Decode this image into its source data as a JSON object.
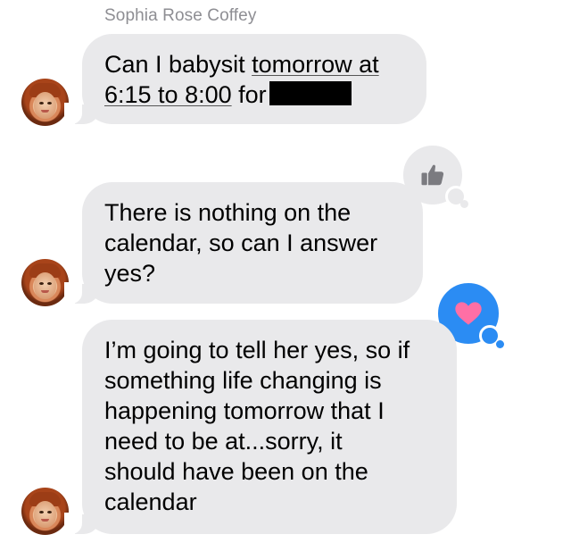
{
  "conversation": {
    "sender_name": "Sophia Rose Coffey",
    "messages": [
      {
        "line1_prefix": "Can I babysit ",
        "line1_link": "tomorrow at",
        "line2_link": "6:15 to 8:00",
        "line2_suffix": " for",
        "redacted": true
      },
      {
        "text_line1": "There is nothing on the",
        "text_line2": "calendar, so can I answer",
        "text_line3": "yes?",
        "reaction": "thumbs-up-icon"
      },
      {
        "text_line1": "I’m going to tell her yes, so if",
        "text_line2": "something life changing is",
        "text_line3": "happening tomorrow that I",
        "text_line4": "need to be at...sorry, it",
        "text_line5": "should have been on the",
        "text_line6": "calendar",
        "reaction": "heart-icon"
      }
    ]
  },
  "colors": {
    "bubble_gray": "#e9e9eb",
    "sender_name_gray": "#8e8e93",
    "tapback_blue": "#2b8cf3",
    "heart_pink": "#ff6fa5",
    "thumb_gray": "#7b7b80"
  }
}
